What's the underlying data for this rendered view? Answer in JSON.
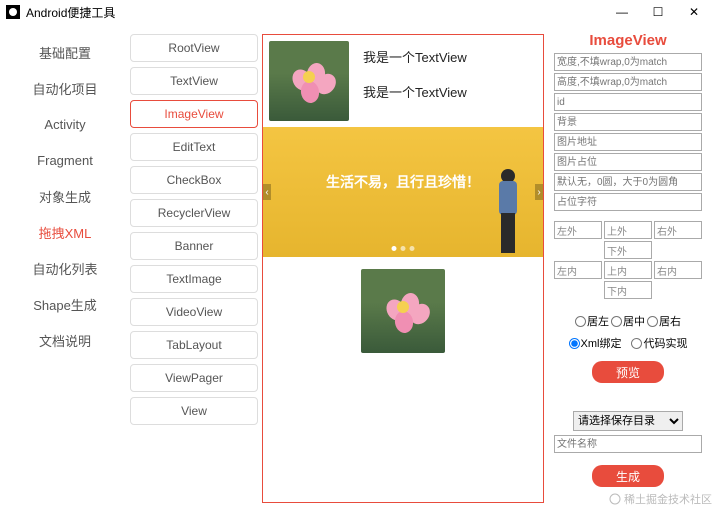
{
  "window": {
    "title": "Android便捷工具"
  },
  "nav": {
    "items": [
      {
        "label": "基础配置"
      },
      {
        "label": "自动化项目"
      },
      {
        "label": "Activity"
      },
      {
        "label": "Fragment"
      },
      {
        "label": "对象生成"
      },
      {
        "label": "拖拽XML"
      },
      {
        "label": "自动化列表"
      },
      {
        "label": "Shape生成"
      },
      {
        "label": "文档说明"
      }
    ],
    "active_index": 5
  },
  "views": {
    "items": [
      "RootView",
      "TextView",
      "ImageView",
      "EditText",
      "CheckBox",
      "RecyclerView",
      "Banner",
      "TextImage",
      "VideoView",
      "TabLayout",
      "ViewPager",
      "View"
    ],
    "active_index": 2
  },
  "preview": {
    "text1": "我是一个TextView",
    "text2": "我是一个TextView",
    "banner_text": "生活不易，且行且珍惜！"
  },
  "props": {
    "title": "ImageView",
    "fields": [
      "宽度,不填wrap,0为match",
      "高度,不填wrap,0为match",
      "id",
      "背景",
      "图片地址",
      "图片占位",
      "默认无，0圆，大于0为圆角",
      "占位字符"
    ],
    "margins": {
      "lo": "左外",
      "to": "上外",
      "ro": "右外",
      "bo": "下外",
      "li": "左内",
      "ti": "上内",
      "ri": "右内",
      "bi": "下内"
    },
    "align": {
      "l": "居左",
      "c": "居中",
      "r": "居右"
    },
    "mode": {
      "xml": "Xml绑定",
      "code": "代码实现"
    },
    "preview_btn": "预览",
    "save_sel": "请选择保存目录",
    "filename_ph": "文件名称",
    "gen_btn": "生成"
  },
  "watermark": "稀土掘金技术社区"
}
